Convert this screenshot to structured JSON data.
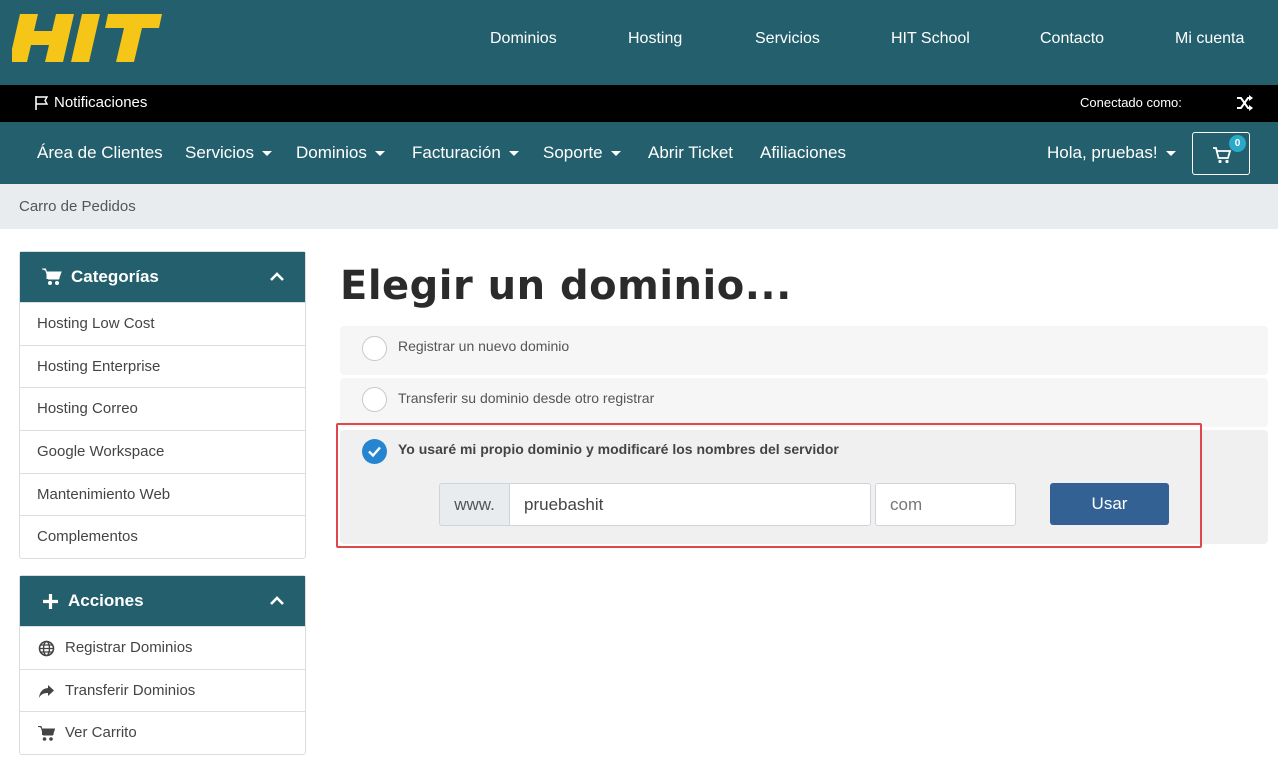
{
  "brand": {
    "logo_text": "HIT",
    "logo_color": "#f5c518",
    "primary_color": "#235f6c"
  },
  "topnav": [
    "Dominios",
    "Hosting",
    "Servicios",
    "HIT School",
    "Contacto",
    "Mi cuenta"
  ],
  "notifbar": {
    "notifications": "Notificaciones",
    "connected_as": "Conectado como:"
  },
  "mainnav": {
    "items": [
      "Área de Clientes",
      "Servicios",
      "Dominios",
      "Facturación",
      "Soporte",
      "Abrir Ticket",
      "Afiliaciones"
    ],
    "greeting": "Hola, pruebas!",
    "cart_count": "0"
  },
  "breadcrumb": "Carro de Pedidos",
  "sidebar": {
    "categories": {
      "title": "Categorías",
      "items": [
        "Hosting Low Cost",
        "Hosting Enterprise",
        "Hosting Correo",
        "Google Workspace",
        "Mantenimiento Web",
        "Complementos"
      ]
    },
    "actions": {
      "title": "Acciones",
      "items": [
        {
          "label": "Registrar Dominios",
          "icon": "globe-icon"
        },
        {
          "label": "Transferir Dominios",
          "icon": "share-arrow-icon"
        },
        {
          "label": "Ver Carrito",
          "icon": "cart-icon"
        }
      ]
    }
  },
  "main": {
    "title": "Elegir un dominio...",
    "options": [
      {
        "label": "Registrar un nuevo dominio",
        "checked": false
      },
      {
        "label": "Transferir su dominio desde otro registrar",
        "checked": false
      },
      {
        "label": "Yo usaré mi propio dominio y modificaré los nombres del servidor",
        "checked": true
      }
    ],
    "domain_prefix": "www.",
    "domain_value": "pruebashit",
    "tld_value": "com",
    "use_button": "Usar"
  },
  "highlight_color": "#e0474c"
}
